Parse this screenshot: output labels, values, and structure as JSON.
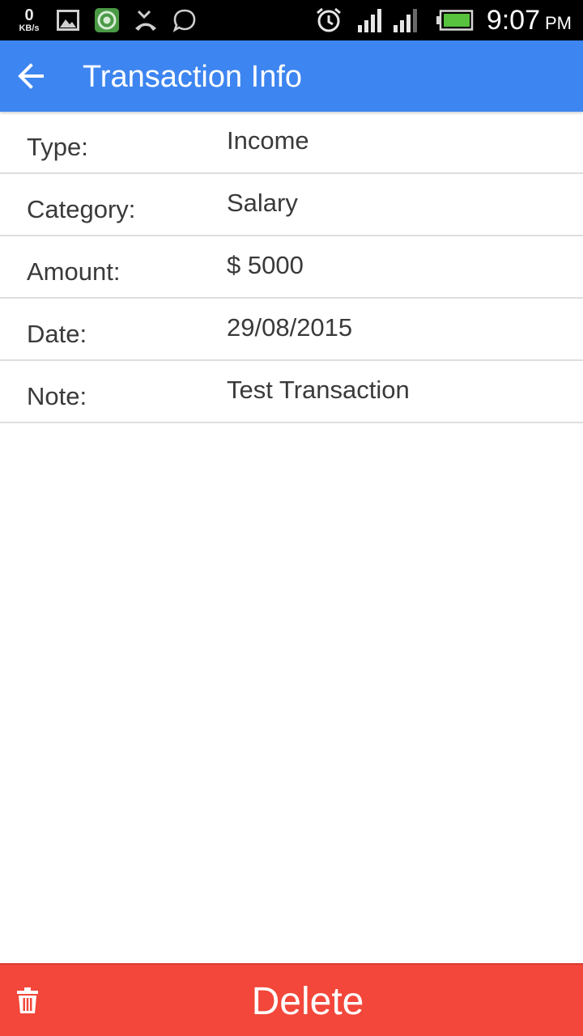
{
  "status_bar": {
    "net_speed_value": "0",
    "net_speed_unit": "KB/s",
    "time": "9:07",
    "ampm": "PM",
    "icons": [
      "image-icon",
      "app-ring-icon",
      "missed-call-icon",
      "chat-bubble-icon",
      "alarm-icon",
      "signal-icon",
      "signal-icon",
      "battery-icon"
    ]
  },
  "app_bar": {
    "title": "Transaction Info",
    "back_icon": "arrow-left-icon",
    "background": "#3d85f0"
  },
  "rows": [
    {
      "label": "Type:",
      "value": "Income"
    },
    {
      "label": "Category:",
      "value": "Salary"
    },
    {
      "label": "Amount:",
      "value": "$ 5000"
    },
    {
      "label": "Date:",
      "value": "29/08/2015"
    },
    {
      "label": "Note:",
      "value": "Test Transaction"
    }
  ],
  "delete_bar": {
    "label": "Delete",
    "icon": "trash-icon",
    "background": "#f2473a"
  }
}
